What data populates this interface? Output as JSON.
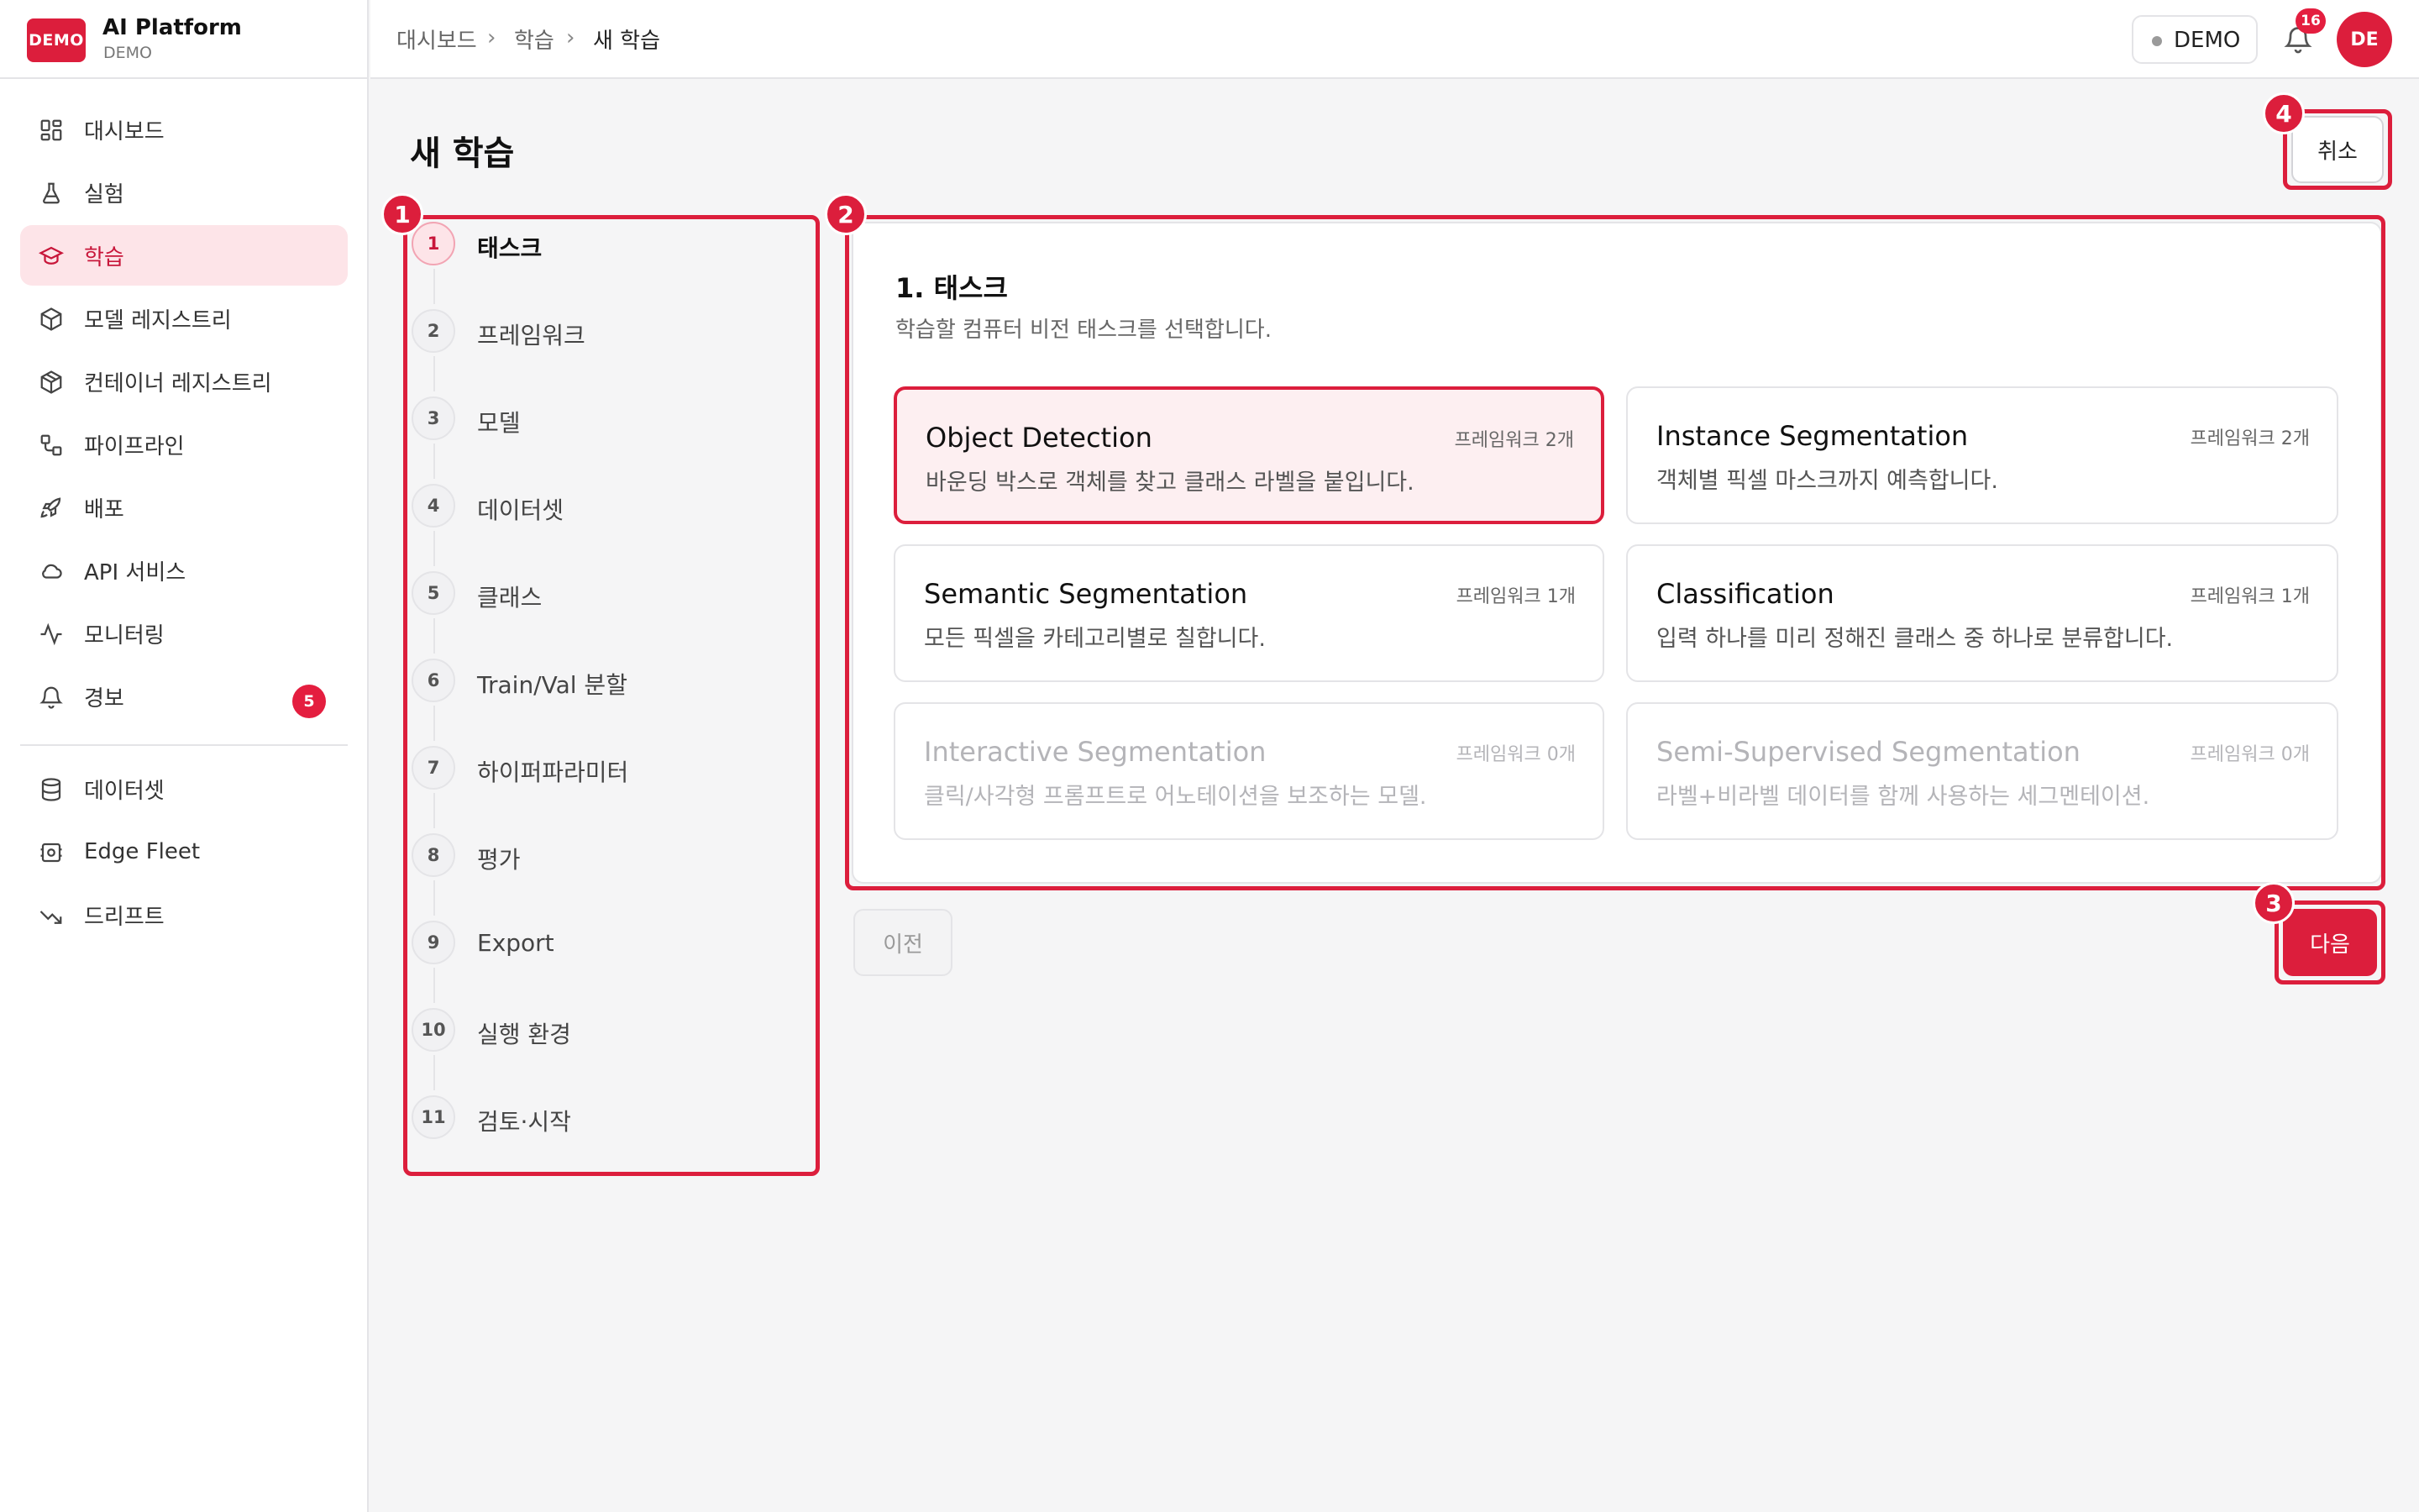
{
  "brand": {
    "logo": "DEMO",
    "name": "AI Platform",
    "sub": "DEMO"
  },
  "sidebar": {
    "items": [
      {
        "label": "대시보드",
        "icon": "dashboard-icon"
      },
      {
        "label": "실험",
        "icon": "flask-icon"
      },
      {
        "label": "학습",
        "icon": "graduation-cap-icon",
        "active": true
      },
      {
        "label": "모델 레지스트리",
        "icon": "box-icon"
      },
      {
        "label": "컨테이너 레지스트리",
        "icon": "package-icon"
      },
      {
        "label": "파이프라인",
        "icon": "pipeline-icon"
      },
      {
        "label": "배포",
        "icon": "rocket-icon"
      },
      {
        "label": "API 서비스",
        "icon": "cloud-icon"
      },
      {
        "label": "모니터링",
        "icon": "activity-icon"
      },
      {
        "label": "경보",
        "icon": "bell-icon",
        "badge": "5"
      }
    ],
    "items2": [
      {
        "label": "데이터셋",
        "icon": "database-icon"
      },
      {
        "label": "Edge Fleet",
        "icon": "cpu-icon"
      },
      {
        "label": "드리프트",
        "icon": "trending-down-icon"
      }
    ]
  },
  "header": {
    "breadcrumb": [
      "대시보드",
      "학습",
      "새 학습"
    ],
    "env": "DEMO",
    "notifications": "16",
    "avatar": "DE"
  },
  "page": {
    "title": "새 학습",
    "cancel": "취소"
  },
  "steps": [
    {
      "num": "1",
      "label": "태스크"
    },
    {
      "num": "2",
      "label": "프레임워크"
    },
    {
      "num": "3",
      "label": "모델"
    },
    {
      "num": "4",
      "label": "데이터셋"
    },
    {
      "num": "5",
      "label": "클래스"
    },
    {
      "num": "6",
      "label": "Train/Val 분할"
    },
    {
      "num": "7",
      "label": "하이퍼파라미터"
    },
    {
      "num": "8",
      "label": "평가"
    },
    {
      "num": "9",
      "label": "Export"
    },
    {
      "num": "10",
      "label": "실행 환경"
    },
    {
      "num": "11",
      "label": "검토·시작"
    }
  ],
  "panel": {
    "title": "1. 태스크",
    "subtitle": "학습할 컴퓨터 비전 태스크를 선택합니다.",
    "options": [
      {
        "title": "Object Detection",
        "meta": "프레임워크 2개",
        "desc": "바운딩 박스로 객체를 찾고 클래스 라벨을 붙입니다."
      },
      {
        "title": "Instance Segmentation",
        "meta": "프레임워크 2개",
        "desc": "객체별 픽셀 마스크까지 예측합니다."
      },
      {
        "title": "Semantic Segmentation",
        "meta": "프레임워크 1개",
        "desc": "모든 픽셀을 카테고리별로 칠합니다."
      },
      {
        "title": "Classification",
        "meta": "프레임워크 1개",
        "desc": "입력 하나를 미리 정해진 클래스 중 하나로 분류합니다."
      },
      {
        "title": "Interactive Segmentation",
        "meta": "프레임워크 0개",
        "desc": "클릭/사각형 프롬프트로 어노테이션을 보조하는 모델."
      },
      {
        "title": "Semi-Supervised Segmentation",
        "meta": "프레임워크 0개",
        "desc": "라벨+비라벨 데이터를 함께 사용하는 세그멘테이션."
      }
    ]
  },
  "footer": {
    "prev": "이전",
    "next": "다음"
  },
  "annotations": [
    "1",
    "2",
    "3",
    "4"
  ],
  "colors": {
    "accent": "#dc1e3c",
    "accent_bg": "#fde4e8",
    "background": "#f5f5f6"
  }
}
